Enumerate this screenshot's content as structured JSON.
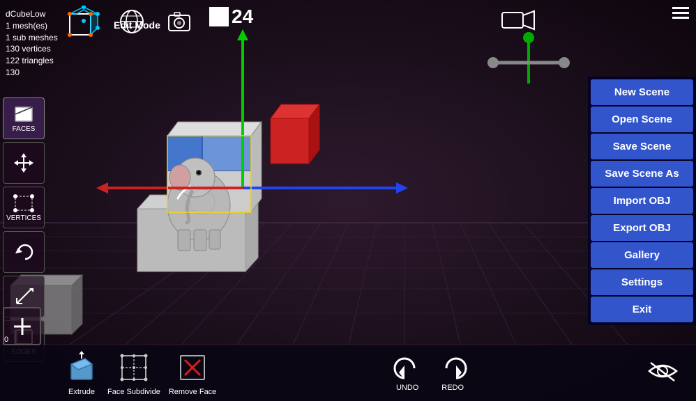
{
  "info": {
    "object_name": "dCubeLow",
    "mesh_count": "1 mesh(es)",
    "sub_meshes": "1 sub meshes",
    "vertices": "130 vertices",
    "triangles": "122 triangles",
    "extra": "130"
  },
  "edit_mode": {
    "label": "Edit Mode"
  },
  "frame_counter": {
    "value": "24"
  },
  "coord_display": {
    "value": "0"
  },
  "tools": {
    "faces_label": "FACES",
    "vertices_label": "VERTICES",
    "edges_label": "EDGES"
  },
  "menu": {
    "new_scene": "New Scene",
    "open_scene": "Open Scene",
    "save_scene": "Save Scene",
    "save_scene_as": "Save Scene As",
    "import_obj": "Import OBJ",
    "export_obj": "Export OBJ",
    "gallery": "Gallery",
    "settings": "Settings",
    "exit": "Exit"
  },
  "bottom_toolbar": {
    "extrude_label": "Extrude",
    "face_subdivide_label": "Face Subdivide",
    "remove_face_label": "Remove Face",
    "undo_label": "UNDO",
    "redo_label": "REDO"
  },
  "colors": {
    "menu_bg": "#3355cc",
    "axis_green": "#00cc00",
    "axis_red": "#cc2222",
    "axis_blue": "#2244ee"
  }
}
